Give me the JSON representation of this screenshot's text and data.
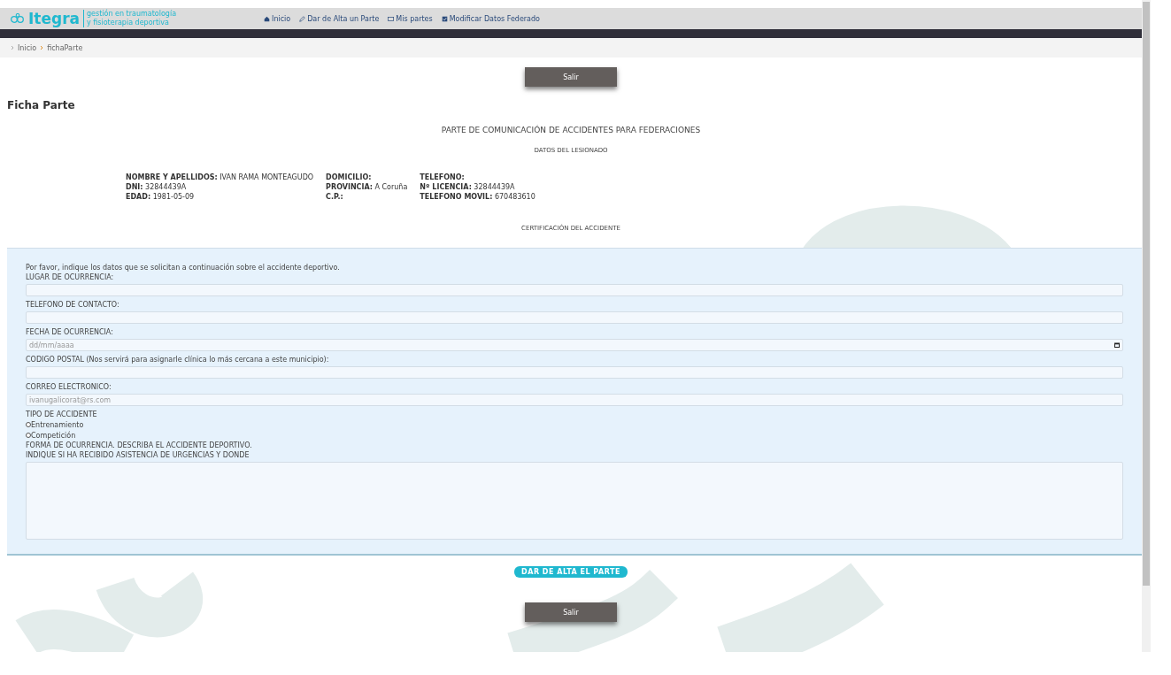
{
  "header": {
    "logo": "Itegra",
    "tagline": [
      "gestión en traumatología",
      "y fisioterapia deportiva"
    ],
    "nav": [
      {
        "label": "Inicio"
      },
      {
        "label": "Dar de Alta un Parte"
      },
      {
        "label": "Mis partes"
      },
      {
        "label": "Modificar Datos Federado"
      }
    ]
  },
  "breadcrumb": [
    "Inicio",
    "fichaParte"
  ],
  "exit_button_top": "Salir",
  "page_title": "Ficha Parte",
  "form_title": "PARTE DE COMUNICACIÓN DE ACCIDENTES PARA FEDERACIONES",
  "section_title": "DATOS DEL LESIONADO",
  "patient": [
    [
      {
        "label": "NOMBRE Y APELLIDOS:",
        "value": "IVAN RAMA MONTEAGUDO"
      },
      {
        "label": "DNI:",
        "value": "32844439A"
      },
      {
        "label": "EDAD:",
        "value": "1981-05-09"
      }
    ],
    [
      {
        "label": "DOMICILIO:"
      },
      {
        "label": "PROVINCIA:",
        "value": "A Coruña"
      },
      {
        "label": "C.P.:"
      }
    ],
    [
      {
        "label": "TELEFONO:"
      },
      {
        "label": "Nº LICENCIA:",
        "value": "32844439A"
      },
      {
        "label": "TELEFONO MOVIL:",
        "value": "670483610"
      }
    ]
  ],
  "certification_title": "CERTIFICACIÓN DEL ACCIDENTE",
  "intro": "Por favor, indique los datos que se solicitan a continuación sobre el accidente deportivo.",
  "fields": [
    {
      "kind": "text",
      "label": "LUGAR DE OCURRENCIA:"
    },
    {
      "kind": "text",
      "label": "TELEFONO DE CONTACTO:"
    },
    {
      "kind": "date",
      "label": "FECHA DE OCURRENCIA:",
      "placeholder": "dd/mm/aaaa"
    },
    {
      "kind": "text",
      "label": "CODIGO POSTAL (Nos servirá para asignarle clínica lo más cercana a este municipio):"
    },
    {
      "kind": "text",
      "label": "CORREO ELECTRONICO:",
      "placeholder": "ivanugalicorat@rs.com"
    },
    {
      "kind": "radio",
      "label": "TIPO DE ACCIDENTE",
      "options": [
        {
          "label": "Entrenamiento",
          "selected": false
        },
        {
          "label": "Competición",
          "selected": false
        }
      ]
    },
    {
      "kind": "textarea",
      "label": "FORMA DE OCURRENCIA. DESCRIBA EL ACCIDENTE DEPORTIVO.",
      "label2": "INDIQUE SI HA RECIBIDO ASISTENCIA DE URGENCIAS Y DONDE"
    }
  ],
  "submit_button": "DAR DE ALTA EL PARTE",
  "exit_button_bottom": "Salir"
}
